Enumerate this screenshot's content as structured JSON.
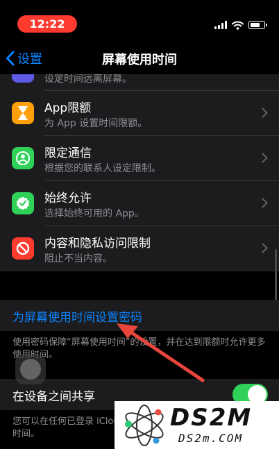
{
  "status_bar": {
    "time": "12:22"
  },
  "nav": {
    "back_label": "设置",
    "title": "屏幕使用时间"
  },
  "list": {
    "partial_row_subtitle": "设定时间远离屏幕。",
    "items": [
      {
        "title": "App限额",
        "subtitle": "为 App 设置时间限额。",
        "icon": "hourglass-icon",
        "color": "#ff9f0a"
      },
      {
        "title": "限定通信",
        "subtitle": "根据您的联系人设定限制。",
        "icon": "person-circle-icon",
        "color": "#30d158"
      },
      {
        "title": "始终允许",
        "subtitle": "选择始终可用的 App。",
        "icon": "checkmark-seal-icon",
        "color": "#30d158"
      },
      {
        "title": "内容和隐私访问限制",
        "subtitle": "阻止不当内容。",
        "icon": "no-entry-icon",
        "color": "#ff3b30"
      }
    ]
  },
  "passcode": {
    "link_label": "为屏幕使用时间设置密码",
    "footer": "使用密码保障“屏幕使用时间”的设置，并在达到限额时允许更多使用时间。"
  },
  "share": {
    "label": "在设备之间共享",
    "enabled": true,
    "footer": "您可以在任何已登录 iCloud 的设备上启用此设置以合屏幕使用时间。"
  },
  "colors": {
    "accent": "#0a84ff",
    "toggle_on": "#30d158",
    "annotation_arrow": "#e8453c"
  },
  "watermark": {
    "main": "DS2M",
    "sub": "DS2m.COM"
  }
}
